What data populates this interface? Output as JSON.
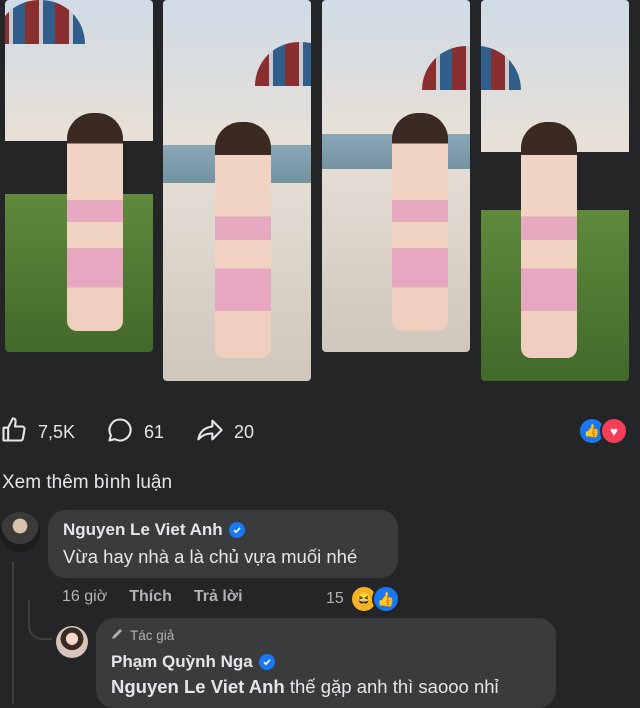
{
  "actions": {
    "like_count": "7,5K",
    "comment_count": "61",
    "share_count": "20"
  },
  "view_more_comments": "Xem thêm bình luận",
  "comments": [
    {
      "author": "Nguyen Le Viet Anh",
      "text": "Vừa hay nhà a là chủ vựa muối nhé",
      "time": "16 giờ",
      "like_label": "Thích",
      "reply_label": "Trả lời",
      "reaction_count": "15"
    },
    {
      "badge": "Tác giả",
      "author": "Phạm Quỳnh Nga",
      "mention": "Nguyen Le Viet Anh",
      "text": " thế gặp anh thì saooo nhỉ"
    }
  ],
  "colors": {
    "background": "#242526",
    "bubble": "#3a3b3c",
    "primary_text": "#e4e6eb",
    "secondary_text": "#b0b3b8",
    "facebook_blue": "#1877f2",
    "love_red": "#f33e58"
  },
  "icons": [
    "like-icon",
    "comment-icon",
    "share-icon",
    "verified-icon",
    "pen-icon",
    "haha-emoji-icon",
    "like-reaction-icon",
    "love-reaction-icon"
  ]
}
